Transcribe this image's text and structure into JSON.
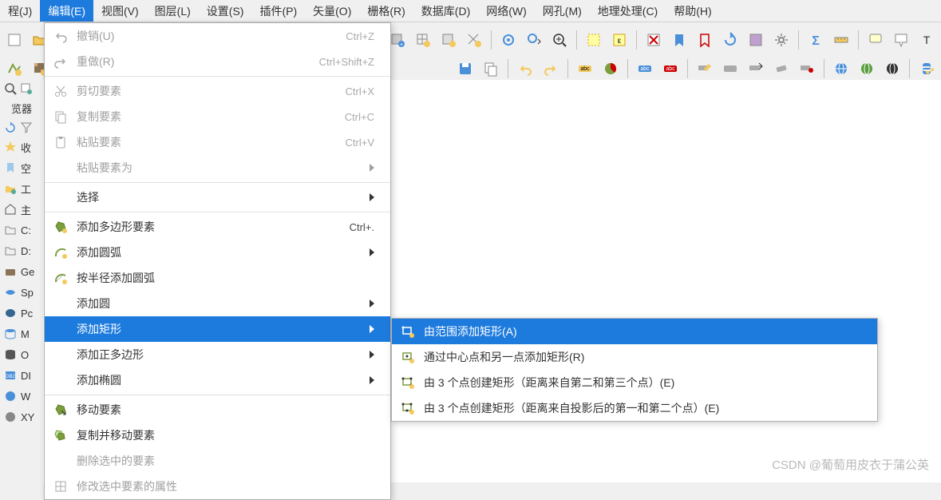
{
  "menubar": {
    "items": [
      {
        "text": "程(J)",
        "key": "J"
      },
      {
        "text": "编辑(E)",
        "key": "E",
        "active": true
      },
      {
        "text": "视图(V)",
        "key": "V"
      },
      {
        "text": "图层(L)",
        "key": "L"
      },
      {
        "text": "设置(S)",
        "key": "S"
      },
      {
        "text": "插件(P)",
        "key": "P"
      },
      {
        "text": "矢量(O)",
        "key": "O"
      },
      {
        "text": "栅格(R)",
        "key": "R"
      },
      {
        "text": "数据库(D)",
        "key": "D"
      },
      {
        "text": "网络(W)",
        "key": "W"
      },
      {
        "text": "网孔(M)",
        "key": "M"
      },
      {
        "text": "地理处理(C)",
        "key": "C"
      },
      {
        "text": "帮助(H)",
        "key": "H"
      }
    ]
  },
  "edit_menu": {
    "items": [
      {
        "icon": "undo",
        "label": "撤销(U)",
        "shortcut": "Ctrl+Z",
        "disabled": true
      },
      {
        "icon": "redo",
        "label": "重做(R)",
        "shortcut": "Ctrl+Shift+Z",
        "disabled": true
      },
      {
        "type": "sep"
      },
      {
        "icon": "cut",
        "label": "剪切要素",
        "shortcut": "Ctrl+X",
        "disabled": true
      },
      {
        "icon": "copy",
        "label": "复制要素",
        "shortcut": "Ctrl+C",
        "disabled": true
      },
      {
        "icon": "paste",
        "label": "粘贴要素",
        "shortcut": "Ctrl+V",
        "disabled": true
      },
      {
        "label": "粘贴要素为",
        "submenu": true,
        "disabled": true
      },
      {
        "type": "sep"
      },
      {
        "label": "选择",
        "submenu": true
      },
      {
        "type": "sep"
      },
      {
        "icon": "polygon-add",
        "label": "添加多边形要素",
        "shortcut": "Ctrl+."
      },
      {
        "icon": "arc-add",
        "label": "添加圆弧",
        "submenu": true
      },
      {
        "icon": "arc-radius",
        "label": "按半径添加圆弧"
      },
      {
        "label": "添加圆",
        "submenu": true
      },
      {
        "label": "添加矩形",
        "submenu": true,
        "highlighted": true
      },
      {
        "label": "添加正多边形",
        "submenu": true
      },
      {
        "label": "添加椭圆",
        "submenu": true
      },
      {
        "type": "sep"
      },
      {
        "icon": "move",
        "label": "移动要素"
      },
      {
        "icon": "copy-move",
        "label": "复制并移动要素"
      },
      {
        "label": "删除选中的要素",
        "disabled": true
      },
      {
        "icon": "edit-attr",
        "label": "修改选中要素的属性",
        "disabled": true
      }
    ]
  },
  "rect_submenu": {
    "items": [
      {
        "icon": "rect-extent",
        "label": "由范围添加矩形(A)",
        "highlighted": true
      },
      {
        "icon": "rect-center",
        "label": "通过中心点和另一点添加矩形(R)"
      },
      {
        "icon": "rect-3pt",
        "label": "由 3 个点创建矩形（距离来自第二和第三个点）(E)"
      },
      {
        "icon": "rect-3pt-proj",
        "label": "由 3 个点创建矩形（距离来自投影后的第一和第二个点）(E)"
      }
    ]
  },
  "side_panel": {
    "header": "览器",
    "items": [
      {
        "icon": "star",
        "text": "收"
      },
      {
        "icon": "bookmark",
        "text": "空"
      },
      {
        "icon": "home-folder",
        "text": "工"
      },
      {
        "icon": "home",
        "text": "主"
      },
      {
        "icon": "folder",
        "text": "C:"
      },
      {
        "icon": "folder",
        "text": "D:"
      },
      {
        "icon": "geopackage",
        "text": "Ge"
      },
      {
        "icon": "spatialite",
        "text": "Sp"
      },
      {
        "icon": "postgres",
        "text": "Pc"
      },
      {
        "icon": "mssql",
        "text": "M"
      },
      {
        "icon": "oracle",
        "text": "O"
      },
      {
        "icon": "db2",
        "text": "DI"
      },
      {
        "icon": "wms",
        "text": "W"
      },
      {
        "icon": "xyz",
        "text": "XY"
      }
    ]
  },
  "watermark": "CSDN @葡萄用皮衣于蒲公英"
}
